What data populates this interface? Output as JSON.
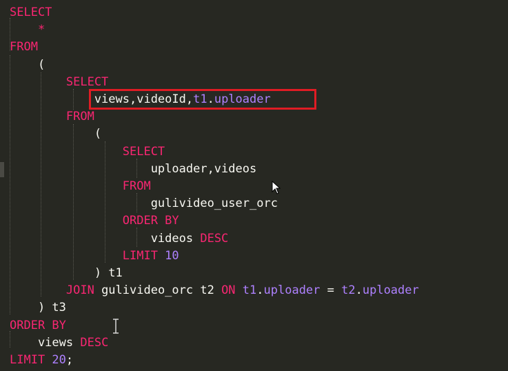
{
  "editor": {
    "lines": [
      {
        "tokens": [
          {
            "t": "SELECT",
            "c": "kw"
          }
        ]
      },
      {
        "tokens": [
          {
            "t": "    *",
            "c": "kw"
          }
        ]
      },
      {
        "tokens": [
          {
            "t": "FROM",
            "c": "kw"
          }
        ]
      },
      {
        "tokens": [
          {
            "t": "    (",
            "c": "id"
          }
        ]
      },
      {
        "tokens": [
          {
            "t": "        SELECT",
            "c": "kw"
          }
        ]
      },
      {
        "tokens": [
          {
            "t": "            views,videoId,",
            "c": "id"
          },
          {
            "t": "t1",
            "c": "tbl"
          },
          {
            "t": ".",
            "c": "id"
          },
          {
            "t": "uploader",
            "c": "tbl"
          }
        ]
      },
      {
        "tokens": [
          {
            "t": "        FROM",
            "c": "kw"
          }
        ]
      },
      {
        "tokens": [
          {
            "t": "            (",
            "c": "id"
          }
        ]
      },
      {
        "tokens": [
          {
            "t": "                SELECT",
            "c": "kw"
          }
        ]
      },
      {
        "tokens": [
          {
            "t": "                    uploader,videos",
            "c": "id"
          }
        ]
      },
      {
        "tokens": [
          {
            "t": "                FROM",
            "c": "kw"
          }
        ]
      },
      {
        "tokens": [
          {
            "t": "                    gulivideo_user_orc",
            "c": "id"
          }
        ]
      },
      {
        "tokens": [
          {
            "t": "                ORDER BY",
            "c": "kw"
          }
        ]
      },
      {
        "tokens": [
          {
            "t": "                    videos ",
            "c": "id"
          },
          {
            "t": "DESC",
            "c": "kw"
          }
        ]
      },
      {
        "tokens": [
          {
            "t": "                LIMIT ",
            "c": "kw"
          },
          {
            "t": "10",
            "c": "num"
          }
        ]
      },
      {
        "tokens": [
          {
            "t": "            ) t1",
            "c": "id"
          }
        ]
      },
      {
        "tokens": [
          {
            "t": "        JOIN ",
            "c": "kw"
          },
          {
            "t": "gulivideo_orc t2 ",
            "c": "id"
          },
          {
            "t": "ON ",
            "c": "kw"
          },
          {
            "t": "t1",
            "c": "tbl"
          },
          {
            "t": ".",
            "c": "id"
          },
          {
            "t": "uploader",
            "c": "tbl"
          },
          {
            "t": " = ",
            "c": "id"
          },
          {
            "t": "t2",
            "c": "tbl"
          },
          {
            "t": ".",
            "c": "id"
          },
          {
            "t": "uploader",
            "c": "tbl"
          }
        ]
      },
      {
        "tokens": [
          {
            "t": "    ) t3",
            "c": "id"
          }
        ]
      },
      {
        "tokens": [
          {
            "t": "ORDER BY",
            "c": "kw"
          }
        ]
      },
      {
        "tokens": [
          {
            "t": "    views ",
            "c": "id"
          },
          {
            "t": "DESC",
            "c": "kw"
          }
        ]
      },
      {
        "tokens": [
          {
            "t": "LIMIT ",
            "c": "kw"
          },
          {
            "t": "20",
            "c": "num"
          },
          {
            "t": ";",
            "c": "id"
          }
        ]
      }
    ]
  },
  "colors": {
    "background": "#272822",
    "keyword": "#f92672",
    "number": "#ae81ff",
    "identifier": "#f8f8f2",
    "highlight_border": "#e01c24"
  },
  "icons": {
    "mouse_cursor": "arrow-cursor-icon",
    "text_cursor": "ibeam-cursor-icon"
  }
}
